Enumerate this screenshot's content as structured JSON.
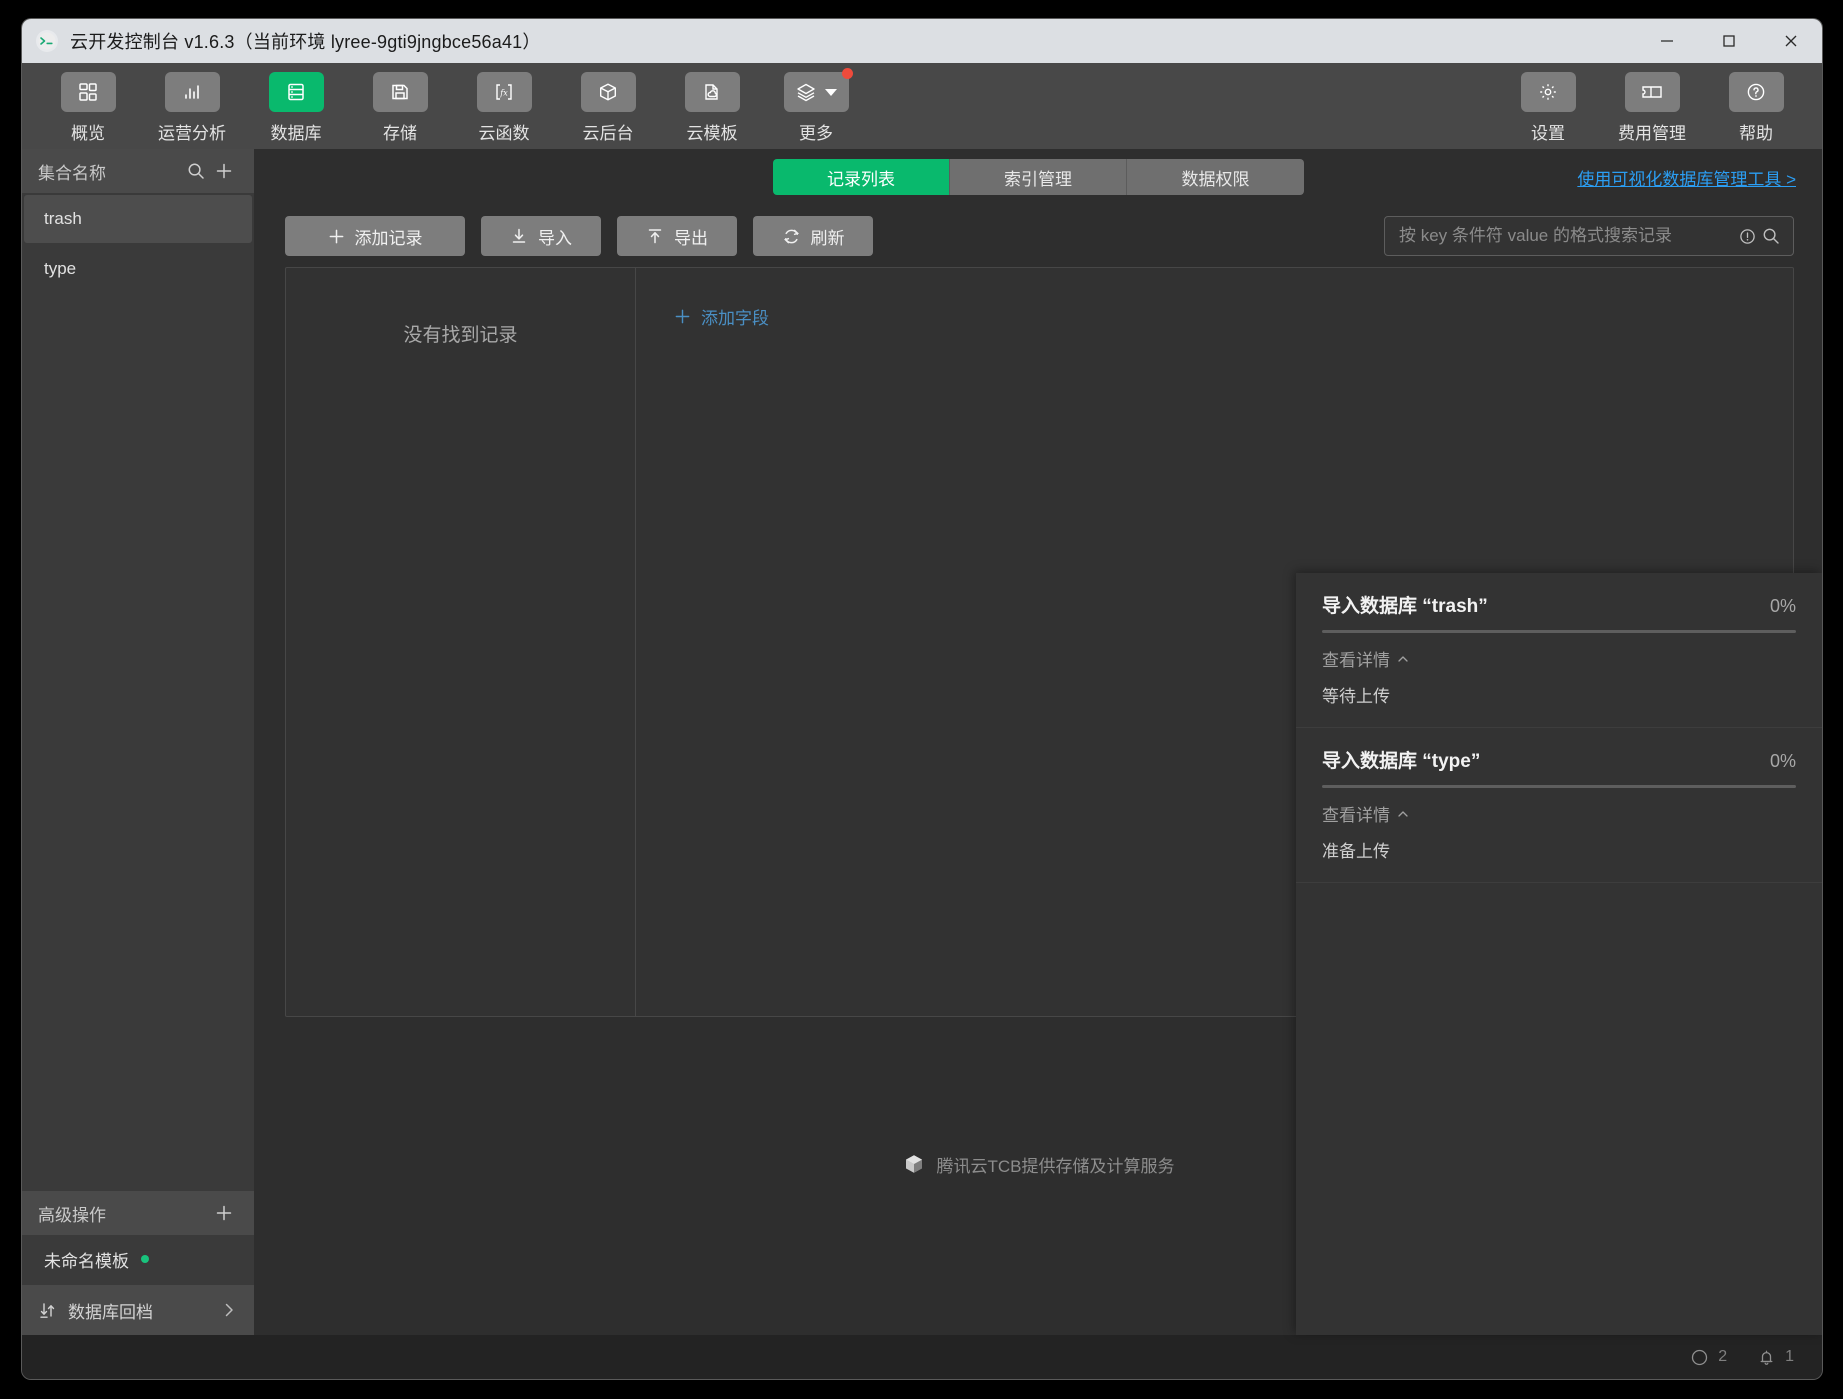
{
  "window": {
    "title": "云开发控制台 v1.6.3（当前环境 lyree-9gti9jngbce56a41）",
    "logo_icon": "app-logo-icon",
    "minimize_label": "minimize",
    "maximize_label": "maximize",
    "close_label": "close"
  },
  "toolbar": {
    "left_items": [
      {
        "label": "概览",
        "icon": "dashboard-grid-icon"
      },
      {
        "label": "运营分析",
        "icon": "bar-chart-icon"
      },
      {
        "label": "数据库",
        "icon": "database-icon",
        "active": true
      },
      {
        "label": "存储",
        "icon": "floppy-save-icon"
      },
      {
        "label": "云函数",
        "icon": "fx-function-icon"
      },
      {
        "label": "云后台",
        "icon": "cube-icon"
      },
      {
        "label": "云模板",
        "icon": "cloud-template-icon"
      },
      {
        "label": "更多",
        "icon": "layers-icon",
        "caret": true,
        "badge": true
      }
    ],
    "right_items": [
      {
        "label": "设置",
        "icon": "gear-icon"
      },
      {
        "label": "费用管理",
        "icon": "ticket-icon"
      },
      {
        "label": "帮助",
        "icon": "help-circle-icon"
      }
    ]
  },
  "sidebar": {
    "header_title": "集合名称",
    "search_icon": "search-icon",
    "add_icon": "plus-icon",
    "collections": [
      {
        "name": "trash",
        "selected": true
      },
      {
        "name": "type",
        "selected": false
      }
    ],
    "advanced": {
      "header_title": "高级操作",
      "add_icon": "plus-icon",
      "items": [
        {
          "name": "未命名模板",
          "dot": true
        }
      ]
    },
    "rollback": {
      "label": "数据库回档",
      "icon": "sort-arrows-icon",
      "chevron": "chevron-right-icon"
    }
  },
  "main": {
    "tabs": [
      {
        "label": "记录列表",
        "active": true
      },
      {
        "label": "索引管理",
        "active": false
      },
      {
        "label": "数据权限",
        "active": false
      }
    ],
    "viz_link": "使用可视化数据库管理工具 >",
    "actions": [
      {
        "label": "添加记录",
        "icon": "plus-icon"
      },
      {
        "label": "导入",
        "icon": "download-icon"
      },
      {
        "label": "导出",
        "icon": "upload-icon"
      },
      {
        "label": "刷新",
        "icon": "refresh-icon"
      }
    ],
    "search": {
      "placeholder": "按 key 条件符 value 的格式搜索记录",
      "value": "",
      "info_icon": "info-circle-icon",
      "search_icon": "search-icon"
    },
    "table": {
      "empty_text": "没有找到记录",
      "add_field_label": "添加字段",
      "add_field_icon": "plus-icon"
    },
    "footer_brand": {
      "text": "腾讯云TCB提供存储及计算服务",
      "icon": "tencent-cloud-cube-icon"
    }
  },
  "notifications": [
    {
      "title": "导入数据库 “trash”",
      "percent": "0%",
      "progress": 0,
      "detail_label": "查看详情",
      "detail_icon": "chevron-up-icon",
      "status": "等待上传"
    },
    {
      "title": "导入数据库 “type”",
      "percent": "0%",
      "progress": 0,
      "detail_label": "查看详情",
      "detail_icon": "chevron-up-icon",
      "status": "准备上传"
    }
  ],
  "statusbar": {
    "items": [
      {
        "icon": "circle-progress-icon",
        "count": "2"
      },
      {
        "icon": "bell-icon",
        "count": "1"
      }
    ]
  },
  "colors": {
    "accent_green": "#09b96d",
    "link_blue": "#2b9ef3",
    "badge_red": "#ef4b3c",
    "window_bg": "#2e2e2e",
    "titlebar_bg": "#dcdfe3"
  }
}
